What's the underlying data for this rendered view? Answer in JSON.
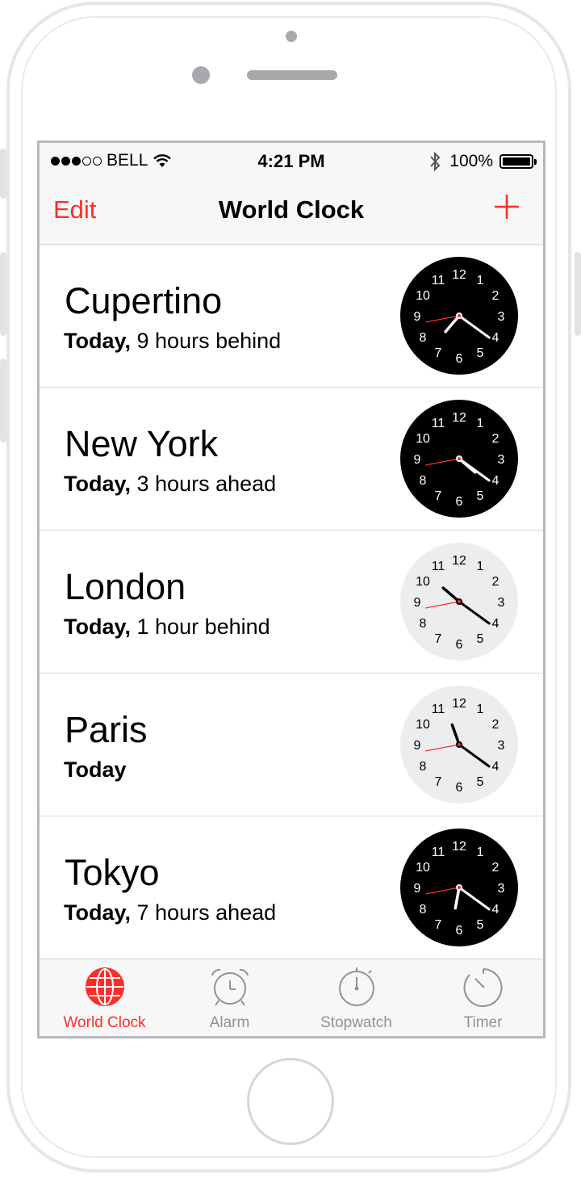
{
  "status_bar": {
    "carrier": "BELL",
    "time": "4:21 PM",
    "battery": "100%",
    "signal_bars_filled": 3,
    "signal_bars_total": 5
  },
  "nav": {
    "edit_label": "Edit",
    "title": "World Clock"
  },
  "clocks": [
    {
      "city": "Cupertino",
      "day": "Today,",
      "offset": " 9 hours behind",
      "hour": 7,
      "minute": 21,
      "theme": "dark"
    },
    {
      "city": "New York",
      "day": "Today,",
      "offset": " 3 hours ahead",
      "hour": 4,
      "minute": 21,
      "theme": "dark"
    },
    {
      "city": "London",
      "day": "Today,",
      "offset": " 1 hour behind",
      "hour": 10,
      "minute": 21,
      "theme": "light"
    },
    {
      "city": "Paris",
      "day": "Today",
      "offset": "",
      "hour": 11,
      "minute": 21,
      "theme": "light"
    },
    {
      "city": "Tokyo",
      "day": "Today,",
      "offset": " 7 hours ahead",
      "hour": 6,
      "minute": 21,
      "theme": "dark"
    }
  ],
  "tabs": [
    {
      "label": "World Clock",
      "icon": "globe-icon",
      "active": true
    },
    {
      "label": "Alarm",
      "icon": "alarm-clock-icon",
      "active": false
    },
    {
      "label": "Stopwatch",
      "icon": "stopwatch-icon",
      "active": false
    },
    {
      "label": "Timer",
      "icon": "timer-icon",
      "active": false
    }
  ],
  "colors": {
    "accent": "#ff2d2a",
    "tab_inactive": "#929292",
    "clock_dark_face": "#000000",
    "clock_light_face": "#ededf0"
  }
}
